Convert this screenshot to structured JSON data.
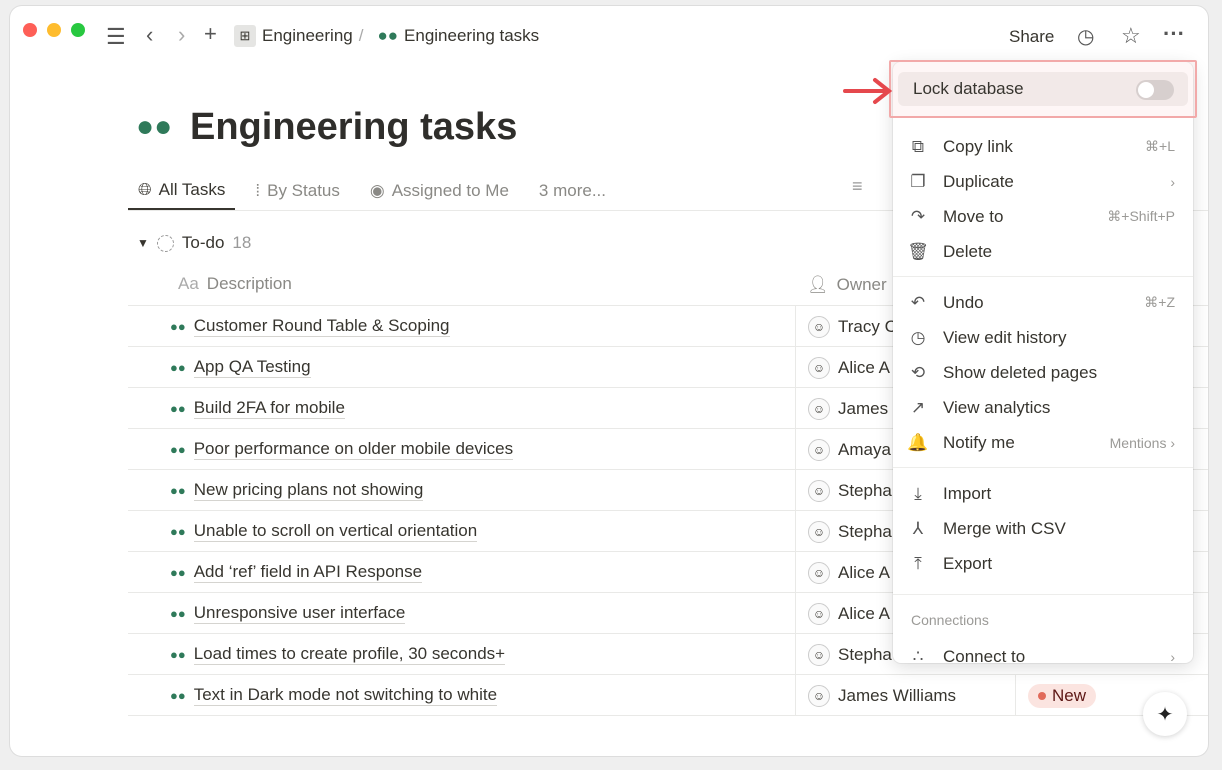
{
  "topbar": {
    "breadcrumb": [
      "Engineering",
      "Engineering tasks"
    ],
    "share": "Share"
  },
  "page": {
    "title": "Engineering tasks"
  },
  "tabs": [
    {
      "label": "All Tasks",
      "icon": "globe-icon"
    },
    {
      "label": "By Status",
      "icon": "traffic-light-icon"
    },
    {
      "label": "Assigned to Me",
      "icon": "person-circle-icon"
    },
    {
      "label": "3 more..."
    }
  ],
  "group": {
    "name": "To-do",
    "count": "18"
  },
  "columns": {
    "description": "Description",
    "description_prefix": "Aa",
    "owner": "Owner"
  },
  "rows": [
    {
      "desc": "Customer Round Table & Scoping",
      "owner": "Tracy C"
    },
    {
      "desc": "App QA Testing",
      "owner": "Alice A"
    },
    {
      "desc": "Build 2FA for mobile",
      "owner": "James"
    },
    {
      "desc": "Poor performance on older mobile devices",
      "owner": "Amaya"
    },
    {
      "desc": "New pricing plans not showing",
      "owner": "Stepha"
    },
    {
      "desc": "Unable to scroll on vertical orientation",
      "owner": "Stepha"
    },
    {
      "desc": "Add ‘ref’ field in API Response",
      "owner": "Alice A"
    },
    {
      "desc": "Unresponsive user interface",
      "owner": "Alice A"
    },
    {
      "desc": "Load times to create profile, 30 seconds+",
      "owner": "Stepha"
    },
    {
      "desc": "Text in Dark mode not switching to white",
      "owner": "James Williams",
      "status": "New"
    }
  ],
  "menu": {
    "lock": {
      "label": "Lock database",
      "on": false
    },
    "items": [
      {
        "label": "Copy link",
        "shortcut": "⌘+L",
        "icon": "link-icon",
        "glyph": "⧉"
      },
      {
        "label": "Duplicate",
        "shortcut": "›",
        "icon": "duplicate-icon",
        "glyph": "❐"
      },
      {
        "label": "Move to",
        "shortcut": "⌘+Shift+P",
        "icon": "move-arrow-icon",
        "glyph": "↷"
      },
      {
        "label": "Delete",
        "shortcut": "",
        "icon": "trash-icon",
        "glyph": "🗑"
      },
      {
        "label": "Undo",
        "shortcut": "⌘+Z",
        "icon": "undo-icon",
        "glyph": "↶"
      },
      {
        "label": "View edit history",
        "shortcut": "",
        "icon": "clock-icon",
        "glyph": "◷"
      },
      {
        "label": "Show deleted pages",
        "shortcut": "",
        "icon": "restore-icon",
        "glyph": "⟲"
      },
      {
        "label": "View analytics",
        "shortcut": "",
        "icon": "chart-line-icon",
        "glyph": "↗"
      },
      {
        "label": "Notify me",
        "shortcut": "Mentions ›",
        "icon": "bell-icon",
        "glyph": "🔔"
      },
      {
        "label": "Import",
        "shortcut": "",
        "icon": "import-icon",
        "glyph": "⤓"
      },
      {
        "label": "Merge with CSV",
        "shortcut": "",
        "icon": "merge-icon",
        "glyph": "⅄"
      },
      {
        "label": "Export",
        "shortcut": "",
        "icon": "export-icon",
        "glyph": "⤒"
      },
      {
        "label": "Connect to",
        "shortcut": "›",
        "icon": "connect-nodes-icon",
        "glyph": "∴"
      }
    ],
    "connections_header": "Connections"
  },
  "colors": {
    "accent_green": "#2f7a5a",
    "highlight": "#f2e9e8",
    "arrow": "#e5484d",
    "badge_bg": "#fbe4e0"
  }
}
